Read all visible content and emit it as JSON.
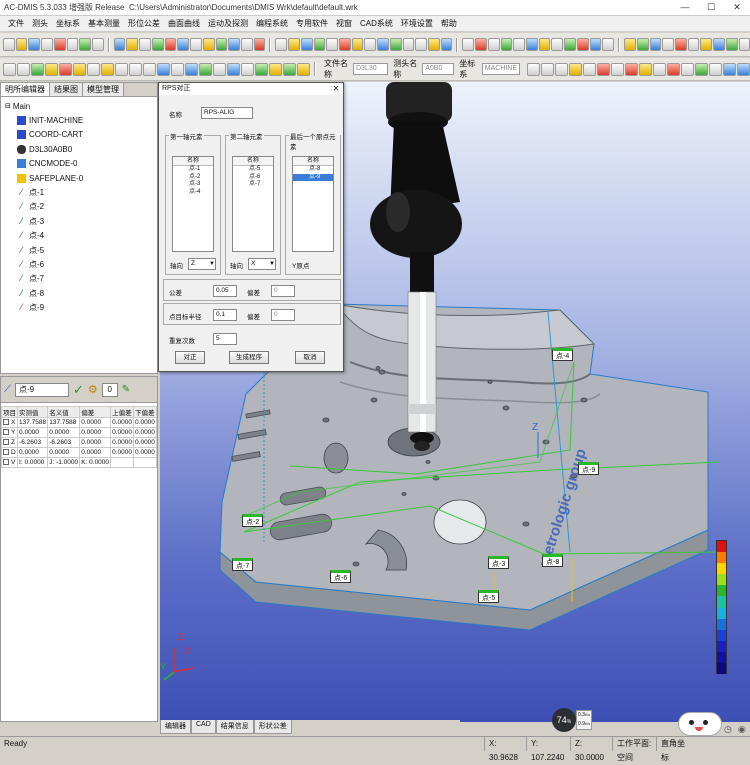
{
  "window": {
    "app_title": "AC-DMIS 5.3.033",
    "edition": "增强版 Release",
    "file_path": "C:\\Users\\Administrator\\Documents\\DMIS Wrk\\default\\default.wrk",
    "minimize_glyph": "—",
    "maximize_glyph": "☐",
    "close_glyph": "✕"
  },
  "menu": [
    "文件",
    "测头",
    "坐标系",
    "基本测量",
    "形位公差",
    "曲面曲线",
    "运动及探测",
    "编程系统",
    "专用软件",
    "视窗",
    "CAD系统",
    "环境设置",
    "帮助"
  ],
  "toolbar2": {
    "file_label": "文件名称",
    "file_value": "D3L30",
    "probe_label": "测头名称",
    "probe_value": "A0B0",
    "csys_label": "坐标系",
    "csys_value": "MACHINE"
  },
  "tree": {
    "tabs": [
      "明所编辑器",
      "结果图",
      "模型管理"
    ],
    "root": "Main",
    "items": [
      {
        "label": "INIT-MACHINE",
        "icon": "program-icon"
      },
      {
        "label": "COORD-CART",
        "icon": "program-icon"
      },
      {
        "label": "D3L30A0B0",
        "icon": "probe-icon"
      },
      {
        "label": "CNCMODE-0",
        "icon": "cnc-icon"
      },
      {
        "label": "SAFEPLANE-0",
        "icon": "plane-icon"
      },
      {
        "label": "点-1",
        "icon": "point-icon"
      },
      {
        "label": "点-2",
        "icon": "point-icon"
      },
      {
        "label": "点-3",
        "icon": "point-icon"
      },
      {
        "label": "点-4",
        "icon": "point-icon"
      },
      {
        "label": "点-5",
        "icon": "point-icon"
      },
      {
        "label": "点-6",
        "icon": "point-icon"
      },
      {
        "label": "点-7",
        "icon": "point-icon"
      },
      {
        "label": "点-8",
        "icon": "point-icon"
      },
      {
        "label": "点-9",
        "icon": "point-red-icon"
      }
    ]
  },
  "feature": {
    "name": "点-9",
    "check": "✓",
    "count": "0",
    "headers": [
      "项目",
      "实测值",
      "名义值",
      "偏差",
      "上偏差",
      "下偏差"
    ],
    "rows": [
      [
        "X",
        "137.7588",
        "137.7588",
        "0.0000",
        "0.0000",
        "0.0000"
      ],
      [
        "Y",
        "0.0000",
        "0.0000",
        "0.0000",
        "0.0000",
        "0.0000"
      ],
      [
        "Z",
        "-6.2603",
        "-6.2603",
        "0.0000",
        "0.0000",
        "0.0000"
      ],
      [
        "D",
        "0.0000",
        "0.0000",
        "0.0000",
        "0.0000",
        "0.0000"
      ],
      [
        "V",
        "I: 0.0000",
        "J: -1.0000",
        "K: 0.0000",
        "",
        ""
      ]
    ]
  },
  "dialog": {
    "title": "RPS对正",
    "name_label": "名称",
    "name_value": "RPS-ALIG",
    "group1": "第一轴元素",
    "group2": "第二轴元素",
    "group3": "最后一个原点元素",
    "list_header": "名称",
    "list1": [
      "点-1",
      "点-2",
      "点-3",
      "点-4"
    ],
    "list2": [
      "点-5",
      "点-6",
      "点-7"
    ],
    "list3": [
      "点-8",
      "点-9"
    ],
    "axis1_label": "轴向",
    "axis1_value": "Z",
    "axis2_label": "轴向",
    "axis2_value": "X",
    "origin_label": "Y原点",
    "tol_label": "公差",
    "tol_value": "0.05",
    "dev_label": "偏差",
    "dev_value": "0",
    "radius_label": "点目标半径",
    "radius_value": "0.1",
    "dev2_label": "偏差",
    "dev2_value": "0",
    "repeat_label": "重复次数",
    "repeat_value": "5",
    "btn_align": "对正",
    "btn_generate": "生成程序",
    "btn_cancel": "取消",
    "close_glyph": "✕"
  },
  "viewport": {
    "point_tags": [
      {
        "label": "点-4",
        "name": "tag-point-4"
      },
      {
        "label": "点-9",
        "name": "tag-point-9"
      },
      {
        "label": "点-2",
        "name": "tag-point-2"
      },
      {
        "label": "点-7",
        "name": "tag-point-7"
      },
      {
        "label": "点-6",
        "name": "tag-point-6"
      },
      {
        "label": "点-3",
        "name": "tag-point-3"
      },
      {
        "label": "点-8",
        "name": "tag-point-8"
      },
      {
        "label": "点-5",
        "name": "tag-point-5"
      }
    ],
    "brand_text": "metrologic group",
    "axis_x": "X",
    "axis_y": "Y",
    "axis_z": "Z",
    "scale_colors": [
      "#e01010",
      "#ff7a00",
      "#ffd400",
      "#9be01a",
      "#2ab82a",
      "#1ec0a0",
      "#18b0e0",
      "#1a70e0",
      "#1a40d8",
      "#1a20c0",
      "#1010a0",
      "#0a0a80"
    ]
  },
  "bottom_tabs": [
    "编辑器",
    "CAD",
    "结果信息",
    "形状公差"
  ],
  "widget": {
    "percent": "74",
    "unit": "%",
    "up": "0.3",
    "down": "0.9",
    "up_unit": "K/s",
    "down_unit": "K/s"
  },
  "status": {
    "ready": "Ready",
    "x": "X: 30.9628",
    "y": "Y: 107.2240",
    "z": "Z: 30.0000",
    "workplane": "工作平面: 空间",
    "angle": "直角坐标"
  }
}
